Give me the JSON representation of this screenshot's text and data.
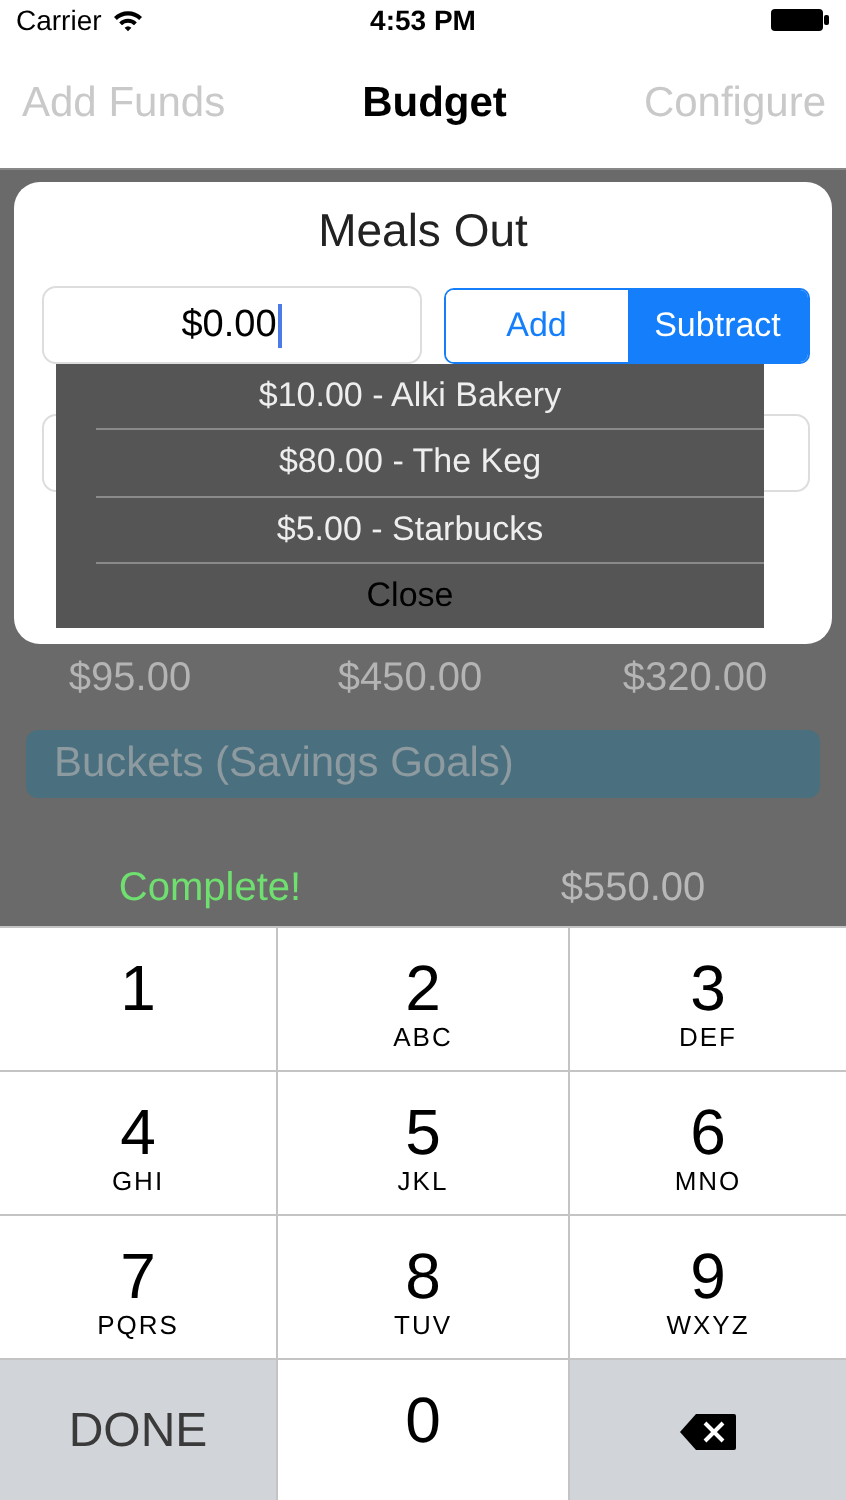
{
  "status_bar": {
    "carrier": "Carrier",
    "time": "4:53 PM"
  },
  "nav_bar": {
    "left_button": "Add Funds",
    "title": "Budget",
    "right_button": "Configure"
  },
  "background": {
    "amounts": [
      "$95.00",
      "$450.00",
      "$320.00"
    ],
    "section_header": "Buckets (Savings Goals)",
    "bucket_status": "Complete!",
    "bucket_amount": "$550.00"
  },
  "modal": {
    "title": "Meals Out",
    "amount": "$0.00",
    "segments": [
      {
        "label": "Add",
        "selected": false
      },
      {
        "label": "Subtract",
        "selected": true
      }
    ],
    "suggestions": [
      "$10.00 - Alki Bakery",
      "$80.00 - The Keg",
      "$5.00 - Starbucks"
    ],
    "close": "Close"
  },
  "keypad": {
    "keys": [
      {
        "kind": "digit",
        "digit": "1"
      },
      {
        "kind": "digit",
        "digit": "2",
        "letters": "ABC"
      },
      {
        "kind": "digit",
        "digit": "3",
        "letters": "DEF"
      },
      {
        "kind": "digit",
        "digit": "4",
        "letters": "GHI"
      },
      {
        "kind": "digit",
        "digit": "5",
        "letters": "JKL"
      },
      {
        "kind": "digit",
        "digit": "6",
        "letters": "MNO"
      },
      {
        "kind": "digit",
        "digit": "7",
        "letters": "PQRS"
      },
      {
        "kind": "digit",
        "digit": "8",
        "letters": "TUV"
      },
      {
        "kind": "digit",
        "digit": "9",
        "letters": "WXYZ"
      },
      {
        "kind": "done",
        "label": "DONE"
      },
      {
        "kind": "digit",
        "digit": "0"
      },
      {
        "kind": "delete"
      }
    ]
  }
}
